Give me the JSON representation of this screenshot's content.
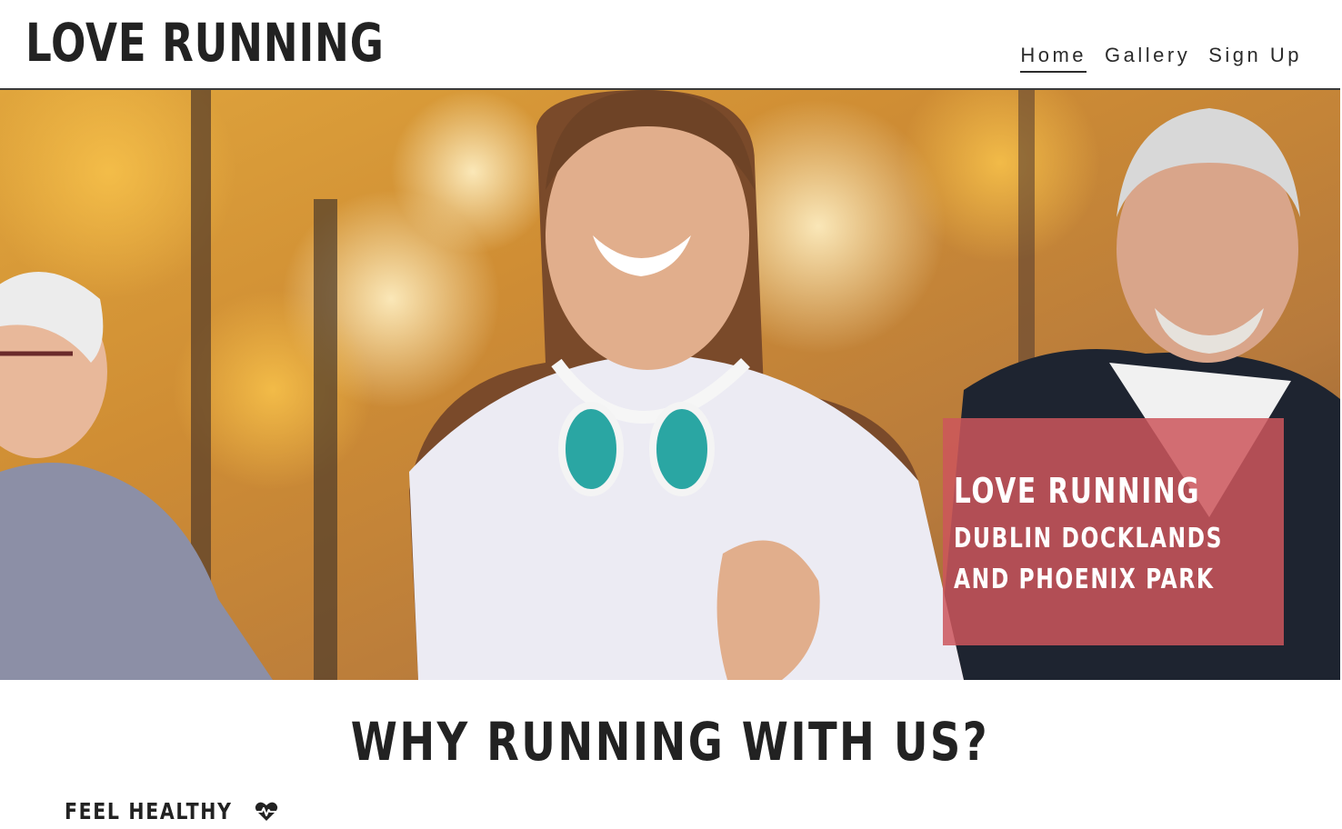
{
  "header": {
    "logo": "LOVE RUNNING",
    "nav": [
      {
        "label": "Home",
        "active": true
      },
      {
        "label": "Gallery",
        "active": false
      },
      {
        "label": "Sign Up",
        "active": false
      }
    ]
  },
  "hero": {
    "title": "LOVE RUNNING",
    "subtitle": "DUBLIN DOCKLANDS AND PHOENIX PARK",
    "overlay_color": "#cd565c"
  },
  "section": {
    "title": "WHY RUNNING WITH US?",
    "feature_label": "FEEL HEALTHY",
    "feature_icon": "heartbeat-icon"
  }
}
